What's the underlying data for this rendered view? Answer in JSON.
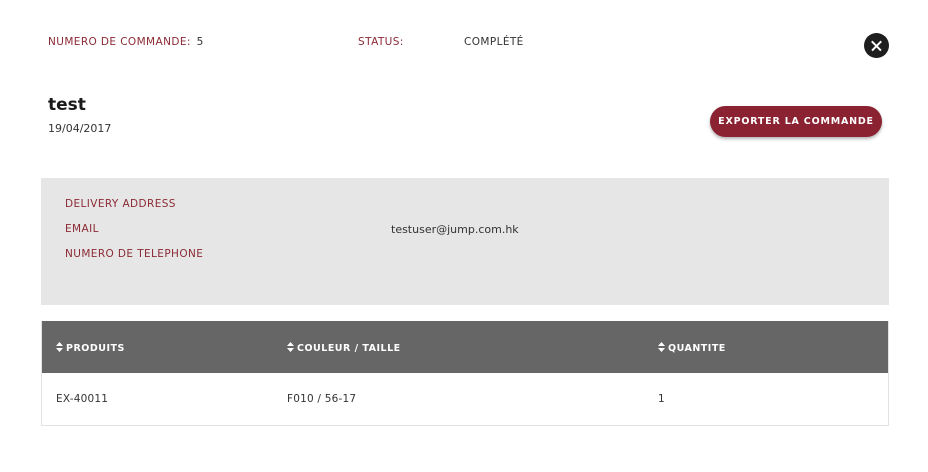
{
  "header": {
    "order_number_label": "NUMERO DE COMMANDE:",
    "order_number_value": "5",
    "status_label": "STATUS:",
    "status_value": "COMPLÉTÉ",
    "close_icon": "close-icon"
  },
  "order": {
    "title": "test",
    "date": "19/04/2017",
    "export_label": "EXPORTER LA COMMANDE"
  },
  "info": {
    "delivery_label": "DELIVERY ADDRESS",
    "delivery_value": "",
    "email_label": "EMAIL",
    "email_value": "testuser@jump.com.hk",
    "phone_label": "NUMERO DE TELEPHONE",
    "phone_value": ""
  },
  "table": {
    "sort_icon": "sort-icon",
    "columns": [
      "PRODUITS",
      "COULEUR / TAILLE",
      "QUANTITE"
    ],
    "rows": [
      [
        "EX-40011",
        "F010 / 56-17",
        "1"
      ]
    ]
  },
  "colors": {
    "accent": "#8b2232",
    "label": "#8b2a35",
    "table_header": "#666666",
    "panel": "#e6e6e6"
  }
}
